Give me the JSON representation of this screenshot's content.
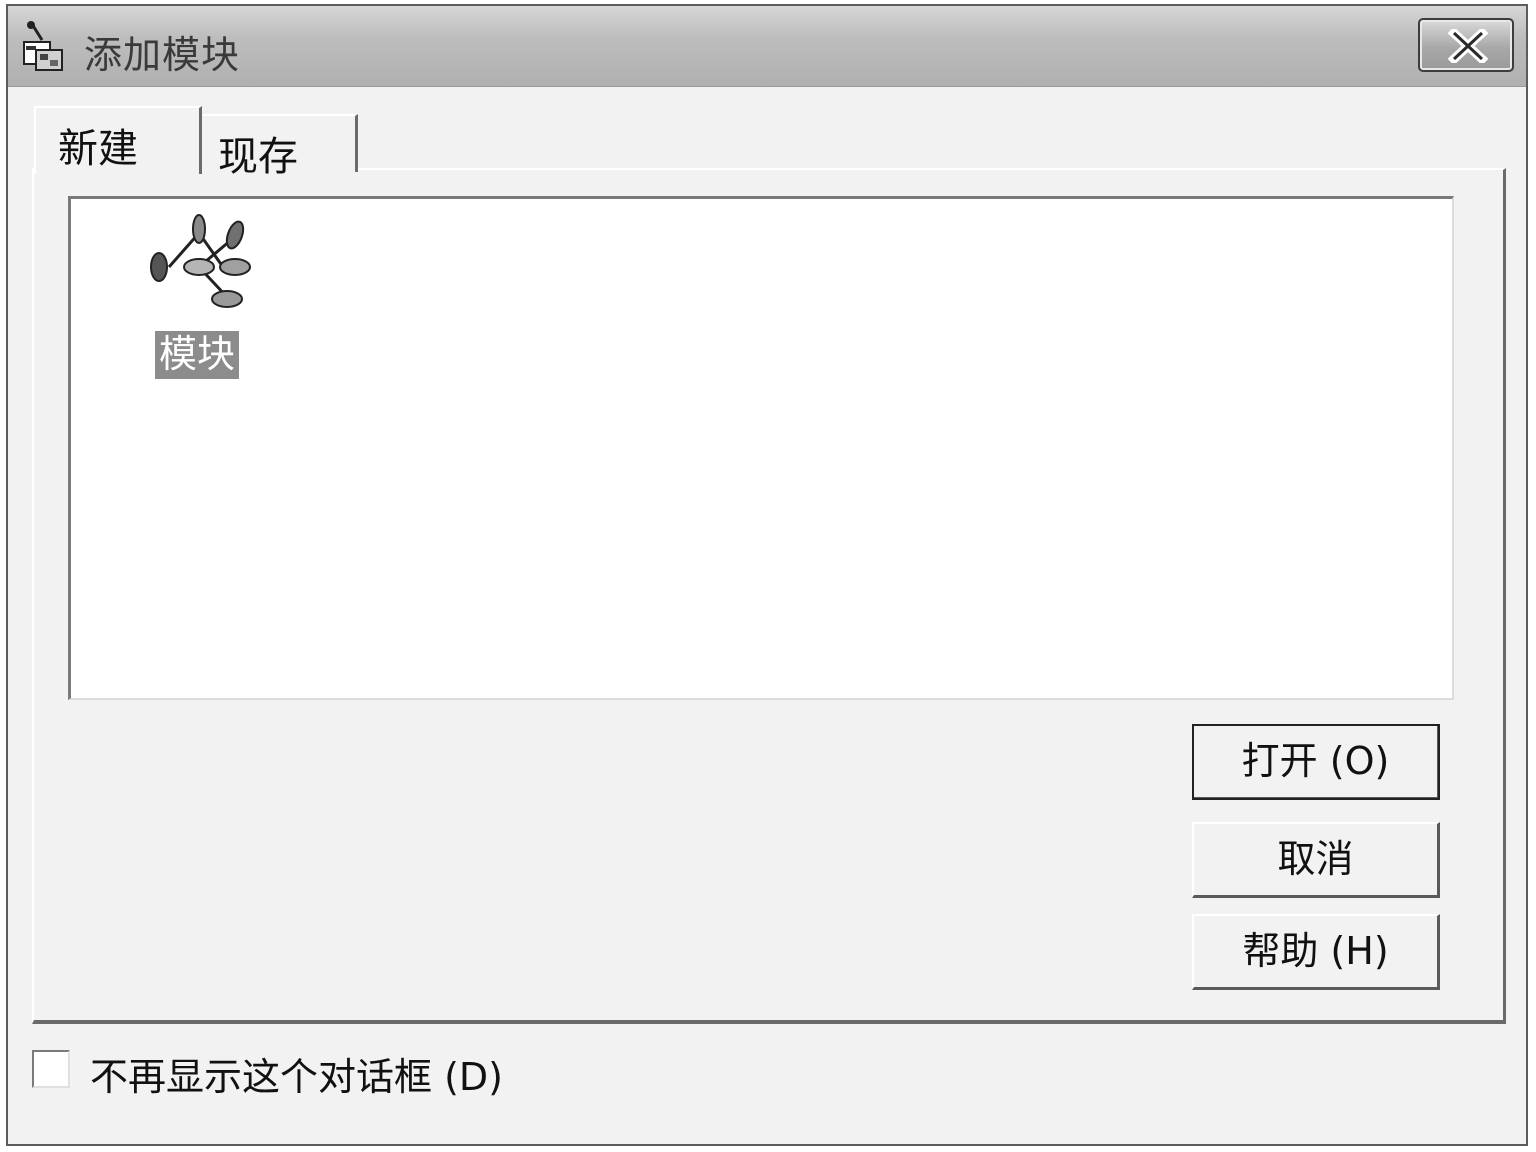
{
  "window": {
    "title": "添加模块",
    "title_icon": "add-module-icon",
    "close_icon": "close-icon"
  },
  "tabs": [
    {
      "label": "新建",
      "selected": true
    },
    {
      "label": "现存",
      "selected": false
    }
  ],
  "listview": {
    "items": [
      {
        "label": "模块",
        "icon": "module-icon",
        "selected": true
      }
    ]
  },
  "buttons": {
    "open": "打开 (O)",
    "cancel": "取消",
    "help": "帮助 (H)"
  },
  "checkbox": {
    "label": "不再显示这个对话框 (D)",
    "checked": false
  },
  "colors": {
    "selection": "#8c8c8c",
    "window_bg": "#f2f2f2"
  }
}
